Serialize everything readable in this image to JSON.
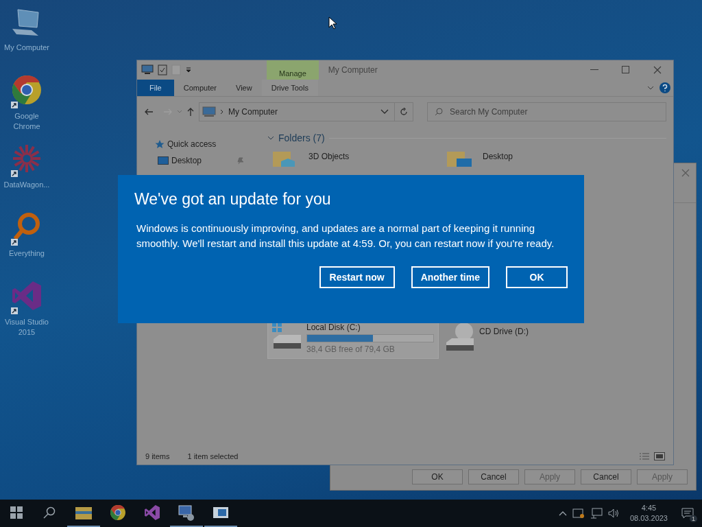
{
  "desktop_icons": [
    {
      "label": "My Computer",
      "kind": "computer",
      "shortcut": false
    },
    {
      "label": "Google Chrome",
      "kind": "chrome",
      "shortcut": true
    },
    {
      "label": "DataWagon...",
      "kind": "datawagon",
      "shortcut": true
    },
    {
      "label": "Everything",
      "kind": "everything",
      "shortcut": true
    },
    {
      "label": "Visual Studio 2015",
      "kind": "vs",
      "shortcut": true
    }
  ],
  "explorer": {
    "title": "My Computer",
    "contextual_tab": "Manage",
    "ribbon_tabs": [
      {
        "label": "File",
        "kind": "file"
      },
      {
        "label": "Computer",
        "kind": "plain"
      },
      {
        "label": "View",
        "kind": "plain"
      },
      {
        "label": "Drive Tools",
        "kind": "contextual"
      }
    ],
    "address": "My Computer",
    "search_placeholder": "Search My Computer",
    "nav": [
      {
        "label": "Quick access",
        "kind": "star",
        "pinned": false
      },
      {
        "label": "Desktop",
        "kind": "desktop",
        "pinned": true
      }
    ],
    "folders_header": "Folders (7)",
    "folders": [
      {
        "name": "3D Objects",
        "kind": "cube"
      },
      {
        "name": "Desktop",
        "kind": "desktop"
      }
    ],
    "drives": [
      {
        "name": "Local Disk (C:)",
        "kind": "hdd",
        "selected": true,
        "level": 0.52,
        "info": "38,4 GB free of 79,4 GB"
      },
      {
        "name": "CD Drive (D:)",
        "kind": "cd",
        "selected": false
      }
    ],
    "status": [
      "9 items",
      "1 item selected"
    ]
  },
  "back_dialog": {
    "buttons": [
      {
        "label": "OK",
        "disabled": false
      },
      {
        "label": "Cancel",
        "disabled": false
      },
      {
        "label": "Apply",
        "disabled": true
      },
      {
        "label": "Cancel",
        "disabled": false
      },
      {
        "label": "Apply",
        "disabled": true
      }
    ]
  },
  "update_dialog": {
    "title": "We've got an update for you",
    "body": "Windows is continuously improving, and updates are a normal part of keeping it running smoothly. We'll restart and install this update at 4:59. Or, you can restart now if you're ready.",
    "buttons": [
      "Restart now",
      "Another time",
      "OK"
    ]
  },
  "taskbar": {
    "apps": [
      {
        "kind": "explorer",
        "running": true
      },
      {
        "kind": "chrome",
        "running": false
      },
      {
        "kind": "vs",
        "running": false
      },
      {
        "kind": "remote",
        "running": true
      },
      {
        "kind": "window",
        "running": true
      }
    ],
    "time": "4:45",
    "date": "08.03.2023",
    "notifications": "1"
  }
}
